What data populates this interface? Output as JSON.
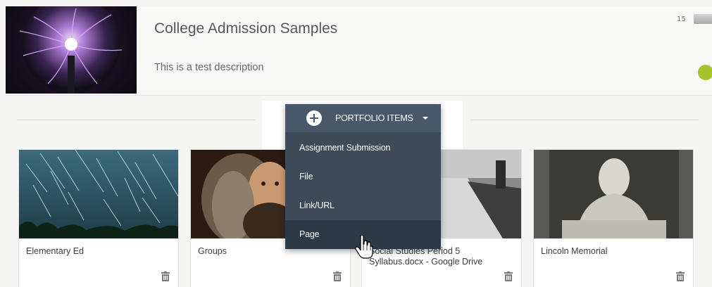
{
  "portfolio": {
    "title": "College Admission Samples",
    "description": "This is a test description",
    "count": "15",
    "status_color": "#a8c42a"
  },
  "menu": {
    "header_label": "PORTFOLIO ITEMS",
    "items": [
      {
        "label": "Assignment Submission"
      },
      {
        "label": "File"
      },
      {
        "label": "Link/URL"
      },
      {
        "label": "Page"
      }
    ]
  },
  "cards": [
    {
      "title": "Elementary Ed"
    },
    {
      "title": "Groups"
    },
    {
      "title": "Social Studies Period 5 Syllabus.docx - Google Drive"
    },
    {
      "title": "Lincoln Memorial"
    }
  ],
  "icons": {
    "add": "plus-circle-icon",
    "dropdown": "caret-down-icon",
    "delete": "trash-icon",
    "cursor": "hand-cursor-icon"
  }
}
